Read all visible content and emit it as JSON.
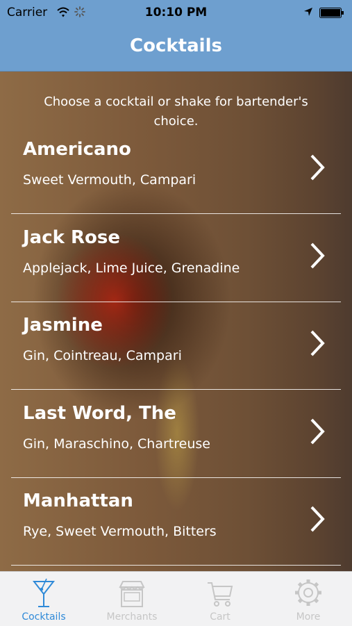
{
  "status_bar": {
    "carrier": "Carrier",
    "time": "10:10 PM"
  },
  "nav": {
    "title": "Cocktails"
  },
  "intro_text": "Choose a cocktail or shake for bartender's choice.",
  "cocktails": [
    {
      "name": "Americano",
      "ingredients": "Sweet Vermouth, Campari"
    },
    {
      "name": "Jack Rose",
      "ingredients": "Applejack, Lime Juice, Grenadine"
    },
    {
      "name": "Jasmine",
      "ingredients": "Gin, Cointreau, Campari"
    },
    {
      "name": "Last Word, The",
      "ingredients": "Gin, Maraschino, Chartreuse"
    },
    {
      "name": "Manhattan",
      "ingredients": "Rye, Sweet Vermouth, Bitters"
    }
  ],
  "tabs": [
    {
      "label": "Cocktails",
      "icon": "cocktail-glass-icon",
      "active": true
    },
    {
      "label": "Merchants",
      "icon": "storefront-icon",
      "active": false
    },
    {
      "label": "Cart",
      "icon": "cart-icon",
      "active": false
    },
    {
      "label": "More",
      "icon": "gear-icon",
      "active": false
    }
  ],
  "colors": {
    "bar_blue": "#6e9fcf",
    "active_tab": "#2f8ad8",
    "inactive_tab": "#c6c6c6"
  }
}
